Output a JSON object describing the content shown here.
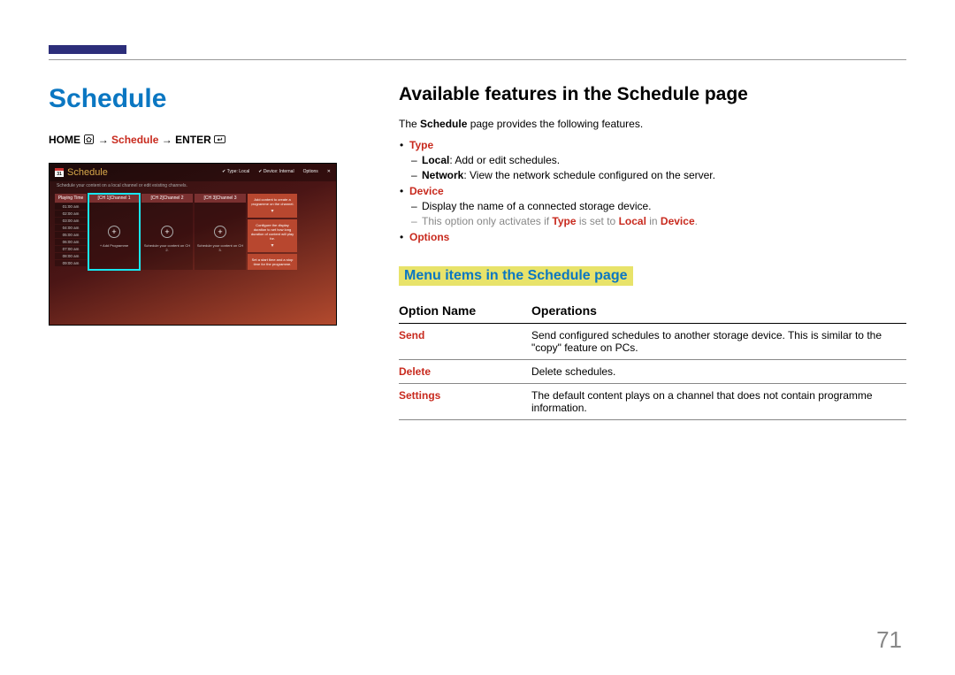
{
  "page_number": "71",
  "left": {
    "heading": "Schedule",
    "nav": {
      "home": "HOME",
      "arrow1": "→",
      "schedule": "Schedule",
      "arrow2": "→",
      "enter": "ENTER"
    },
    "shot": {
      "cal_number": "31",
      "title": "Schedule",
      "top_type": "Type: Local",
      "top_device": "Device: Internal",
      "top_options": "Options",
      "top_close": "✕",
      "subtitle": "Schedule your content on a local channel or edit existing channels.",
      "time_header": "Playing Time",
      "times": [
        "01:00 am",
        "02:00 am",
        "03:00 am",
        "04:00 am",
        "05:00 am",
        "06:00 am",
        "07:00 am",
        "08:00 am",
        "09:00 am"
      ],
      "channels": [
        {
          "hdr": "[CH 1]Channel 1",
          "plus": "+",
          "label": "+ Add Programme"
        },
        {
          "hdr": "[CH 2]Channel 2",
          "plus": "+",
          "label": "Schedule your content on CH 2."
        },
        {
          "hdr": "[CH 3]Channel 3",
          "plus": "+",
          "label": "Schedule your content on CH 3."
        }
      ],
      "tips": [
        "Add content to create a programme on the channel.",
        "Configure the display duration to set how long duration of content will play for.",
        "Set a start time and a stop time for the programme."
      ],
      "tip_arrow": "▾"
    }
  },
  "right": {
    "heading": "Available features in the Schedule page",
    "intro_pre": "The ",
    "intro_bold": "Schedule",
    "intro_post": " page provides the following features.",
    "features": {
      "type": {
        "name": "Type",
        "local_label": "Local",
        "local_text": ": Add or edit schedules.",
        "network_label": "Network",
        "network_text": ": View the network schedule configured on the server."
      },
      "device": {
        "name": "Device",
        "line1": "Display the name of a connected storage device.",
        "gray_pre": "This option only activates if ",
        "gray_type": "Type",
        "gray_mid": " is set to ",
        "gray_local": "Local",
        "gray_mid2": " in ",
        "gray_device": "Device",
        "gray_end": "."
      },
      "options": {
        "name": "Options"
      }
    },
    "subheading": "Menu items in the Schedule page",
    "table": {
      "col1": "Option Name",
      "col2": "Operations",
      "rows": [
        {
          "name": "Send",
          "desc": "Send configured schedules to another storage device. This is similar to the \"copy\" feature on PCs."
        },
        {
          "name": "Delete",
          "desc": "Delete schedules."
        },
        {
          "name": "Settings",
          "desc": "The default content plays on a channel that does not contain programme information."
        }
      ]
    }
  }
}
